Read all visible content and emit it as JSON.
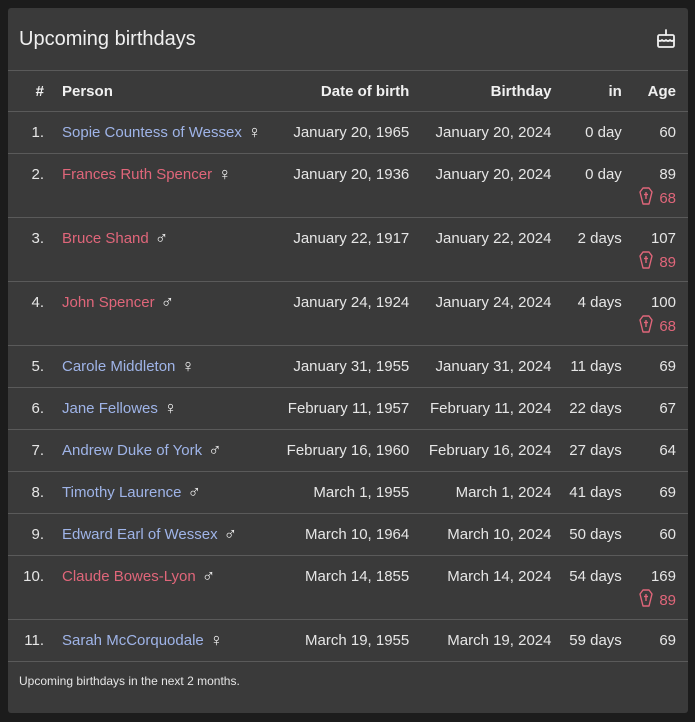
{
  "card": {
    "title": "Upcoming birthdays",
    "footer": "Upcoming birthdays in the next 2 months."
  },
  "columns": {
    "num": "#",
    "person": "Person",
    "dob": "Date of birth",
    "birthday": "Birthday",
    "in": "in",
    "age": "Age"
  },
  "colors": {
    "living_name": "#9fb4e8",
    "deceased_name": "#e0667a",
    "card_bg": "#3a3a3a"
  },
  "rows": [
    {
      "num": "1.",
      "name": "Sopie Countess of Wessex",
      "gender": "♀",
      "dob": "January 20, 1965",
      "birthday": "January 20, 2024",
      "in": "0 day",
      "age": "60",
      "death_age": null
    },
    {
      "num": "2.",
      "name": "Frances Ruth Spencer",
      "gender": "♀",
      "dob": "January 20, 1936",
      "birthday": "January 20, 2024",
      "in": "0 day",
      "age": "89",
      "death_age": "68"
    },
    {
      "num": "3.",
      "name": "Bruce Shand",
      "gender": "♂",
      "dob": "January 22, 1917",
      "birthday": "January 22, 2024",
      "in": "2 days",
      "age": "107",
      "death_age": "89"
    },
    {
      "num": "4.",
      "name": "John Spencer",
      "gender": "♂",
      "dob": "January 24, 1924",
      "birthday": "January 24, 2024",
      "in": "4 days",
      "age": "100",
      "death_age": "68"
    },
    {
      "num": "5.",
      "name": "Carole Middleton",
      "gender": "♀",
      "dob": "January 31, 1955",
      "birthday": "January 31, 2024",
      "in": "11 days",
      "age": "69",
      "death_age": null
    },
    {
      "num": "6.",
      "name": "Jane Fellowes",
      "gender": "♀",
      "dob": "February 11, 1957",
      "birthday": "February 11, 2024",
      "in": "22 days",
      "age": "67",
      "death_age": null
    },
    {
      "num": "7.",
      "name": "Andrew Duke of York",
      "gender": "♂",
      "dob": "February 16, 1960",
      "birthday": "February 16, 2024",
      "in": "27 days",
      "age": "64",
      "death_age": null
    },
    {
      "num": "8.",
      "name": "Timothy Laurence",
      "gender": "♂",
      "dob": "March 1, 1955",
      "birthday": "March 1, 2024",
      "in": "41 days",
      "age": "69",
      "death_age": null
    },
    {
      "num": "9.",
      "name": "Edward Earl of Wessex",
      "gender": "♂",
      "dob": "March 10, 1964",
      "birthday": "March 10, 2024",
      "in": "50 days",
      "age": "60",
      "death_age": null
    },
    {
      "num": "10.",
      "name": "Claude Bowes-Lyon",
      "gender": "♂",
      "dob": "March 14, 1855",
      "birthday": "March 14, 2024",
      "in": "54 days",
      "age": "169",
      "death_age": "89"
    },
    {
      "num": "11.",
      "name": "Sarah McCorquodale",
      "gender": "♀",
      "dob": "March 19, 1955",
      "birthday": "March 19, 2024",
      "in": "59 days",
      "age": "69",
      "death_age": null
    }
  ]
}
